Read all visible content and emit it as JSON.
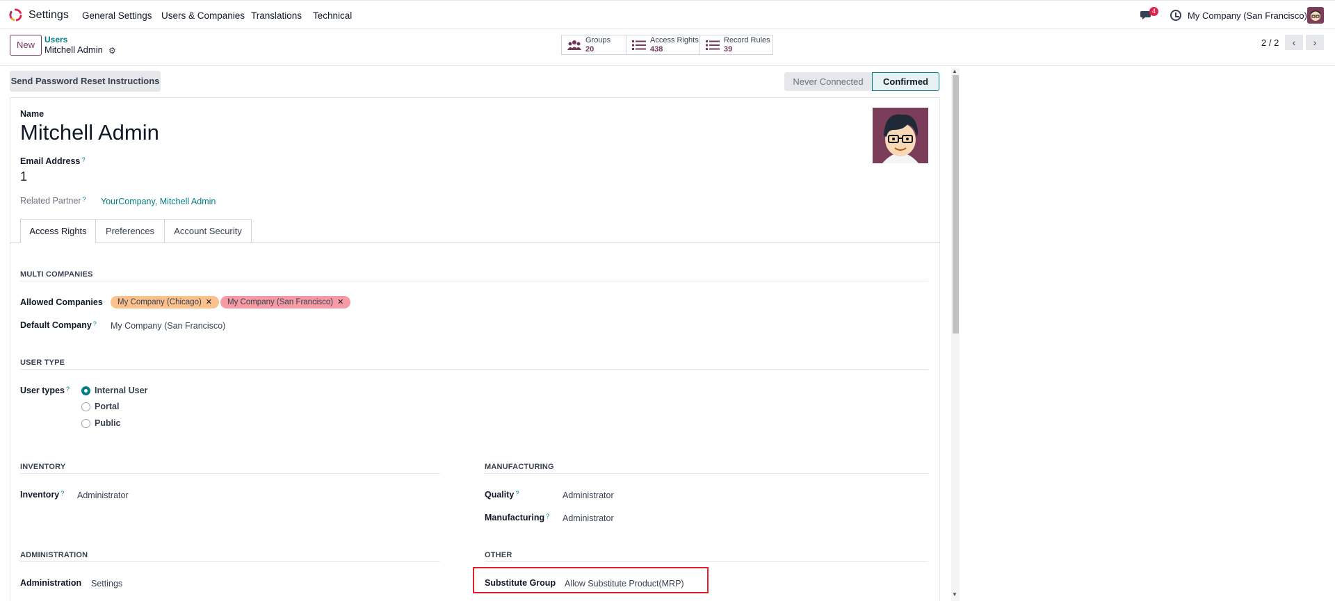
{
  "navbar": {
    "app_name": "Settings",
    "menus": [
      "General Settings",
      "Users & Companies",
      "Translations",
      "Technical"
    ],
    "chat_badge": "4",
    "company": "My Company (San Francisco)"
  },
  "control": {
    "new_label": "New",
    "breadcrumb_parent": "Users",
    "breadcrumb_current": "Mitchell Admin",
    "smart_buttons": [
      {
        "label": "Groups",
        "count": "20",
        "icon": "users-icon"
      },
      {
        "label": "Access Rights",
        "count": "438",
        "icon": "list-icon"
      },
      {
        "label": "Record Rules",
        "count": "39",
        "icon": "list-icon"
      }
    ],
    "pager": "2 / 2"
  },
  "status": {
    "reset_button": "Send Password Reset Instructions",
    "stages": [
      "Never Connected",
      "Confirmed"
    ],
    "current_stage": "Confirmed"
  },
  "form": {
    "name_label": "Name",
    "name_value": "Mitchell Admin",
    "email_label": "Email Address",
    "email_value": "1",
    "partner_label": "Related Partner",
    "partner_value": "YourCompany, Mitchell Admin",
    "help_mark": "?"
  },
  "tabs": [
    "Access Rights",
    "Preferences",
    "Account Security"
  ],
  "multi_companies": {
    "title": "MULTI COMPANIES",
    "allowed_label": "Allowed Companies",
    "allowed_tags": [
      {
        "label": "My Company (Chicago)",
        "color": "#fbc18c"
      },
      {
        "label": "My Company (San Francisco)",
        "color": "#f69aa4"
      }
    ],
    "default_label": "Default Company",
    "default_value": "My Company (San Francisco)"
  },
  "user_type": {
    "title": "USER TYPE",
    "label": "User types",
    "options": [
      "Internal User",
      "Portal",
      "Public"
    ],
    "selected": "Internal User"
  },
  "inventory": {
    "title": "INVENTORY",
    "label": "Inventory",
    "value": "Administrator"
  },
  "manufacturing": {
    "title": "MANUFACTURING",
    "quality_label": "Quality",
    "quality_value": "Administrator",
    "mrp_label": "Manufacturing",
    "mrp_value": "Administrator"
  },
  "administration": {
    "title": "ADMINISTRATION",
    "label": "Administration",
    "value": "Settings"
  },
  "other": {
    "title": "OTHER",
    "label": "Substitute Group",
    "value": "Allow Substitute Product(MRP)"
  },
  "colors": {
    "primary": "#71375b",
    "accent": "#017e84",
    "highlight": "#e11d2e"
  }
}
